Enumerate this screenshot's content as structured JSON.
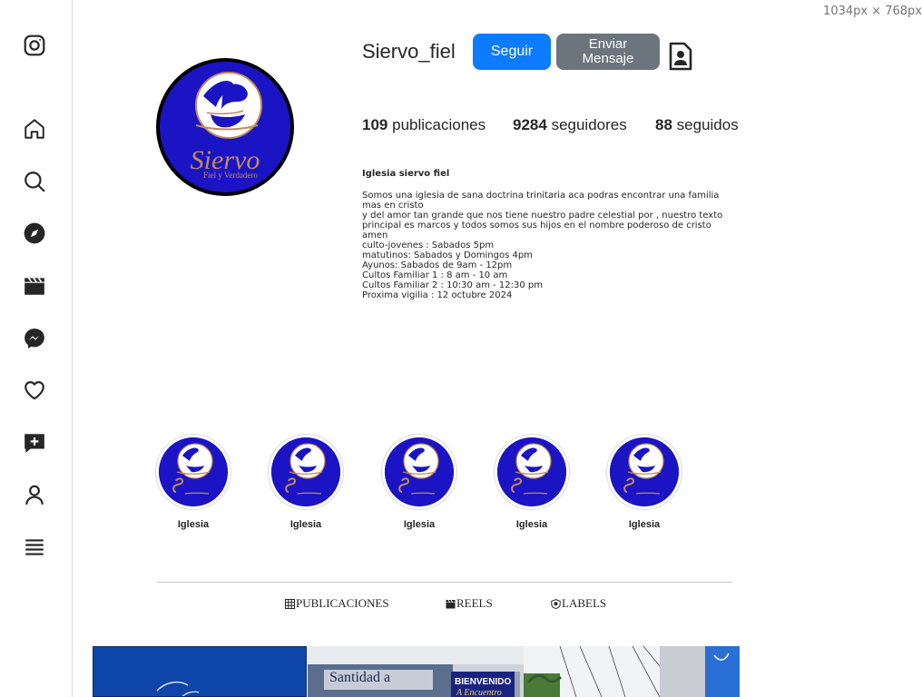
{
  "viewport_readout": "1034px × 768px",
  "nav": {
    "items": [
      {
        "icon": "instagram-logo-icon"
      },
      {
        "icon": "home-icon"
      },
      {
        "icon": "search-icon"
      },
      {
        "icon": "explore-compass-icon"
      },
      {
        "icon": "reels-clapper-icon"
      },
      {
        "icon": "messenger-icon"
      },
      {
        "icon": "heart-icon"
      },
      {
        "icon": "new-post-icon"
      },
      {
        "icon": "profile-icon"
      },
      {
        "icon": "menu-icon"
      }
    ]
  },
  "profile": {
    "username": "Siervo_fiel",
    "follow_label": "Seguir",
    "message_label_line1": "Enviar",
    "message_label_line2": "Mensaje",
    "contact_icon": "contact-card-icon",
    "avatar_logo_title": "Siervo",
    "avatar_logo_subtitle": "Fiel y Verdadero",
    "stats": {
      "posts_count": "109",
      "posts_label": "publicaciones",
      "followers_count": "9284",
      "followers_label": "seguidores",
      "following_count": "88",
      "following_label": "seguidos"
    },
    "bio": {
      "name": "Iglesia siervo fiel",
      "lines": [
        "Somos una iglesia de sana doctrina trinitaria aca podras encontrar una familia mas en cristo",
        "y del amor tan grande que nos tiene nuestro padre celestial por , nuestro texto principal es marcos y todos somos sus hijos en el nombre poderoso de cristo amen",
        "culto-jovenes : Sabados 5pm",
        "matutinos: Sabados y Domingos 4pm",
        "Ayunos: Sabados de 9am - 12pm",
        "Cultos Familiar 1 : 8 am - 10 am",
        "Cultos Familiar 2 : 10:30 am - 12:30 pm",
        "Proxima vigilia : 12 octubre 2024"
      ]
    }
  },
  "highlights": [
    {
      "label": "Iglesia"
    },
    {
      "label": "Iglesia"
    },
    {
      "label": "Iglesia"
    },
    {
      "label": "Iglesia"
    },
    {
      "label": "Iglesia"
    }
  ],
  "tabs": [
    {
      "label": "PUBLICACIONES",
      "icon": "grid-icon"
    },
    {
      "label": "REELS",
      "icon": "clapper-icon"
    },
    {
      "label": "LABELS",
      "icon": "tag-badge-icon"
    }
  ],
  "posts": [
    {
      "caption": ""
    },
    {
      "sign_text": "Santidad a",
      "banner_line1": "BIENVENIDO",
      "banner_line2": "A Encuentro"
    },
    {
      "caption": ""
    }
  ],
  "colors": {
    "follow_blue": "#0d7bff",
    "message_gray": "#6c757d",
    "logo_blue": "#1a14c4",
    "logo_gold": "#c48a5a"
  }
}
